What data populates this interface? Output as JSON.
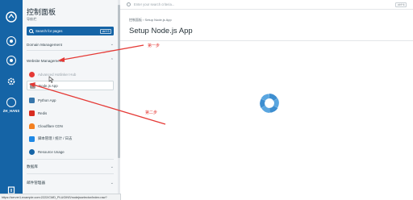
{
  "rail": {
    "user_label": "ZH_HANS"
  },
  "sidebar": {
    "title": "控制面板",
    "subtitle": "导航栏",
    "search": {
      "label": "Search for pages",
      "shortcut": "ctrl+3"
    },
    "sections": {
      "domain_management": "Domain Management",
      "website_management": "Website Management",
      "database": "数据库",
      "mail_management": "邮件管理器"
    },
    "website_items": [
      {
        "label": "Advanced Hotlinker Hub",
        "icon": "hotlink-icon",
        "color": "#e53935"
      },
      {
        "label": "Node.js App",
        "icon": "nodejs-icon",
        "color": "#9e9e9e"
      },
      {
        "label": "Python App",
        "icon": "python-icon",
        "color": "#3776ab"
      },
      {
        "label": "Redis",
        "icon": "redis-icon",
        "color": "#d82c20"
      },
      {
        "label": "Cloudflare CDN",
        "icon": "cloudflare-icon",
        "color": "#f38020"
      },
      {
        "label": "脚本管理 / 统计 / 日志",
        "icon": "script-icon",
        "color": "#1e88e5"
      },
      {
        "label": "Resource Usage",
        "icon": "gauge-icon",
        "color": "#1564a6"
      }
    ]
  },
  "topbar": {
    "search_placeholder": "Enter your search criteria...",
    "shortcut": "ctrl+k"
  },
  "main": {
    "breadcrumb": "控制面板 › Setup Node.js App",
    "title": "Setup Node.js App"
  },
  "annotations": {
    "step1": "第一步",
    "step2": "第二步"
  },
  "status_url": "https://server1.example.com:2222/CMD_PLUGINS/nodejsselector/index.raw?",
  "colors": {
    "brand": "#1564a6",
    "annotation": "#e53935",
    "spinner": "#3d8ed0"
  }
}
